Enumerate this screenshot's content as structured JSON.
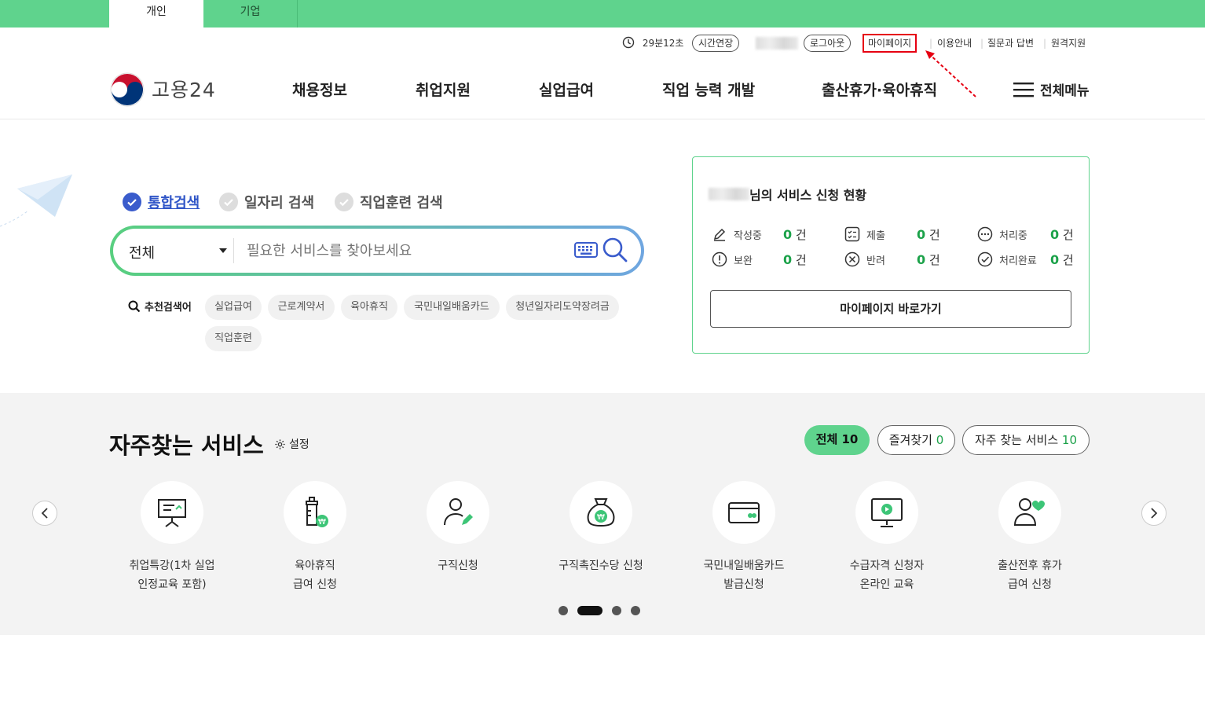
{
  "top_tabs": [
    {
      "label": "개인"
    },
    {
      "label": "기업"
    }
  ],
  "util": {
    "timer": "29분12초",
    "extend": "시간연장",
    "logout": "로그아웃",
    "mypage": "마이페이지",
    "guide": "이용안내",
    "qna": "질문과 답변",
    "remote": "원격지원"
  },
  "logo": {
    "text": "고용24"
  },
  "gnb": [
    "채용정보",
    "취업지원",
    "실업급여",
    "직업 능력 개발",
    "출산휴가·육아휴직"
  ],
  "all_menu": "전체메뉴",
  "search_tabs": [
    "통합검색",
    "일자리 검색",
    "직업훈련 검색"
  ],
  "search": {
    "scope": "전체",
    "placeholder": "필요한 서비스를 찾아보세요"
  },
  "recommend": {
    "label": "추천검색어",
    "keywords": [
      "실업급여",
      "근로계약서",
      "육아휴직",
      "국민내일배움카드",
      "청년일자리도약장려금",
      "직업훈련"
    ]
  },
  "status_card": {
    "title_suffix": "님의 서비스 신청 현황",
    "items": [
      {
        "label": "작성중",
        "count": "0",
        "unit": "건"
      },
      {
        "label": "제출",
        "count": "0",
        "unit": "건"
      },
      {
        "label": "처리중",
        "count": "0",
        "unit": "건"
      },
      {
        "label": "보완",
        "count": "0",
        "unit": "건"
      },
      {
        "label": "반려",
        "count": "0",
        "unit": "건"
      },
      {
        "label": "처리완료",
        "count": "0",
        "unit": "건"
      }
    ],
    "button": "마이페이지 바로가기"
  },
  "frequent": {
    "title": "자주찾는 서비스",
    "settings": "설정",
    "filters": [
      {
        "label": "전체",
        "count": "10"
      },
      {
        "label": "즐겨찾기",
        "count": "0"
      },
      {
        "label": "자주 찾는 서비스",
        "count": "10"
      }
    ],
    "services": [
      {
        "line1": "취업특강(1차 실업",
        "line2": "인정교육 포함)",
        "icon": "presentation-board-icon"
      },
      {
        "line1": "육아휴직",
        "line2": "급여 신청",
        "icon": "baby-bottle-icon"
      },
      {
        "line1": "구직신청",
        "line2": "",
        "icon": "user-edit-icon"
      },
      {
        "line1": "구직촉진수당 신청",
        "line2": "",
        "icon": "money-bag-icon"
      },
      {
        "line1": "국민내일배움카드",
        "line2": "발급신청",
        "icon": "card-icon"
      },
      {
        "line1": "수급자격 신청자",
        "line2": "온라인 교육",
        "icon": "monitor-play-icon"
      },
      {
        "line1": "출산전후 휴가",
        "line2": "급여 신청",
        "icon": "user-heart-icon"
      }
    ]
  },
  "colors": {
    "accent": "#5fd38d",
    "highlight": "#e60012",
    "count_green": "#1ca24a"
  }
}
